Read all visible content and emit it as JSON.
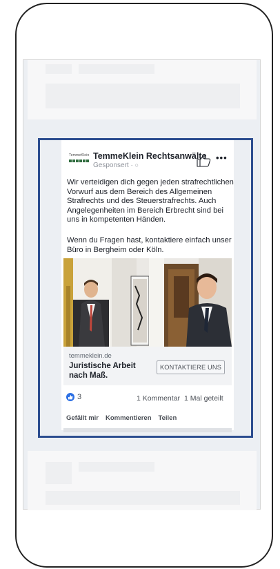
{
  "ad": {
    "page_name": "TemmeKlein Rechtsanwälte",
    "sponsored": "Gesponsert · ",
    "logo_text": "TemmeKlein",
    "paragraph1": "Wir verteidigen dich gegen jeden strafrechtlichen Vorwurf aus dem Bereich des Allgemeinen Strafrechts und des Steuerstrafrechts. Auch Angelegenheiten im Bereich Erbrecht sind bei uns in kompetenten Händen.",
    "paragraph2": "Wenn du Fragen hast, kontaktiere einfach unser Büro in Bergheim oder Köln.",
    "link": {
      "domain": "temmeklein.de",
      "headline": "Juristische Arbeit nach Maß.",
      "cta": "KONTAKTIERE UNS"
    },
    "reactions": {
      "count": "3",
      "comments": "1 Kommentar",
      "shares": "1 Mal geteilt"
    },
    "actions": {
      "like": "Gefällt mir",
      "comment": "Kommentieren",
      "share": "Teilen"
    }
  },
  "colors": {
    "ad_border": "#2c4d8f",
    "facebook_blue": "#2d70e4",
    "logo_green": "#2f6c3e"
  }
}
